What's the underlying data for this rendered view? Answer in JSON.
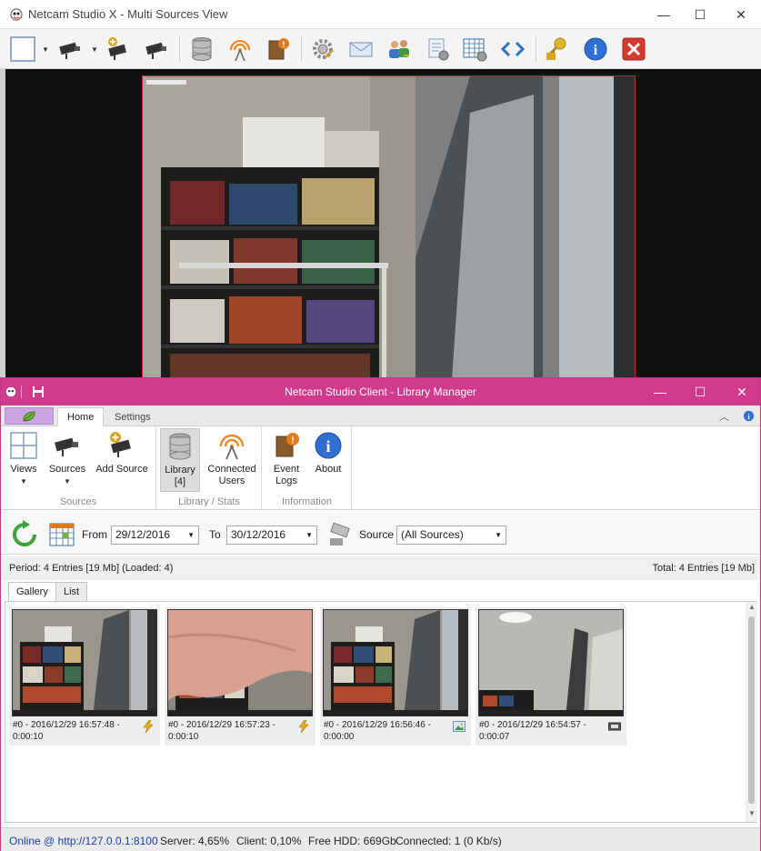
{
  "outer_window": {
    "title": "Netcam Studio X - Multi Sources View",
    "controls": {
      "minimize": "—",
      "maximize": "☐",
      "close": "✕"
    }
  },
  "toolbar": {
    "icons": [
      "view-layout-icon",
      "camera-icon",
      "add-camera-icon",
      "camera-remove-icon",
      "database-icon",
      "broadcast-icon",
      "event-log-icon",
      "settings-gear-icon",
      "email-icon",
      "users-icon",
      "script-icon",
      "schedule-icon",
      "code-icon",
      "key-lock-icon",
      "info-icon",
      "close-red-icon"
    ]
  },
  "inner_window": {
    "title": "Netcam Studio Client - Library Manager",
    "controls": {
      "minimize": "—",
      "maximize": "☐",
      "close": "✕"
    }
  },
  "ribbon": {
    "tabs": [
      {
        "label": "Home",
        "active": true
      },
      {
        "label": "Settings",
        "active": false
      }
    ],
    "groups": [
      {
        "label": "Sources",
        "buttons": [
          {
            "label": "Views",
            "has_dropdown": true,
            "icon": "grid-view-icon"
          },
          {
            "label": "Sources",
            "has_dropdown": true,
            "icon": "camera-icon"
          },
          {
            "label": "Add Source",
            "has_dropdown": false,
            "icon": "add-camera-icon"
          }
        ]
      },
      {
        "label": "Library / Stats",
        "buttons": [
          {
            "label": "Library\n[4]",
            "line1": "Library",
            "line2": "[4]",
            "pressed": true,
            "icon": "database-icon"
          },
          {
            "label": "Connected Users",
            "line1": "Connected",
            "line2": "Users",
            "icon": "broadcast-icon"
          }
        ]
      },
      {
        "label": "Information",
        "buttons": [
          {
            "label": "Event Logs",
            "line1": "Event",
            "line2": "Logs",
            "icon": "event-log-icon"
          },
          {
            "label": "About",
            "icon": "info-icon"
          }
        ]
      }
    ]
  },
  "filter": {
    "from_label": "From",
    "from_value": "29/12/2016",
    "to_label": "To",
    "to_value": "30/12/2016",
    "source_label": "Source",
    "source_value": "(All Sources)"
  },
  "period": {
    "left": "Period: 4 Entries [19 Mb] (Loaded: 4)",
    "right": "Total: 4 Entries [19 Mb]"
  },
  "content_tabs": [
    {
      "label": "Gallery",
      "active": true
    },
    {
      "label": "List",
      "active": false
    }
  ],
  "gallery": [
    {
      "caption_line1": "#0 - 2016/12/29 16:57:48 -",
      "caption_line2": "0:00:10",
      "badge": "lightning-icon",
      "scene": "office"
    },
    {
      "caption_line1": "#0 - 2016/12/29 16:57:23 -",
      "caption_line2": "0:00:10",
      "badge": "lightning-icon",
      "scene": "hand"
    },
    {
      "caption_line1": "#0 - 2016/12/29 16:56:46 -",
      "caption_line2": "0:00:00",
      "badge": "picture-icon",
      "scene": "office"
    },
    {
      "caption_line1": "#0 - 2016/12/29 16:54:57 -",
      "caption_line2": "0:00:07",
      "badge": "film-icon",
      "scene": "ceiling"
    }
  ],
  "status": {
    "online": "Online @ http://127.0.0.1:8100",
    "server": "Server: 4,65%",
    "client": "Client: 0,10%",
    "hdd": "Free HDD: 669Gb",
    "connected": "Connected: 1 (0 Kb/s)"
  },
  "colors": {
    "inner_title_bar": "#cf3a8c",
    "video_border": "#c0263e",
    "status_link": "#1a3f9c"
  }
}
